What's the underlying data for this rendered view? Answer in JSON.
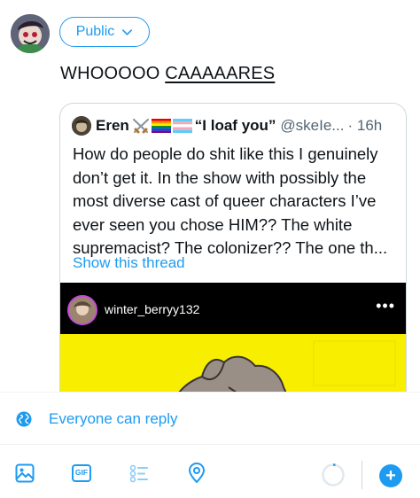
{
  "audience": {
    "label": "Public"
  },
  "compose": {
    "text_plain": "WHOOOOO ",
    "text_underlined": "CAAAAARES"
  },
  "quote": {
    "name": "Eren",
    "name_suffix": "“I loaf you”",
    "handle": "@skeIe...",
    "time": "· 16h",
    "body": "How do people do shit like this I genuinely don’t get it. In the show with possibly the most diverse cast of queer characters I’ve ever seen you chose HIM?? The white supremacist? The colonizer?? The one th...",
    "show_thread": "Show this thread",
    "media": {
      "username": "winter_berryy132",
      "more": "•••"
    }
  },
  "reply_setting": {
    "label": "Everyone can reply"
  },
  "toolbar": {
    "gif_label": "GIF",
    "add": "+"
  },
  "colors": {
    "accent": "#1d9bf0",
    "text": "#0f1419",
    "muted": "#536471",
    "border": "#cfd9de",
    "media_yellow": "#f7ee00"
  },
  "icons": [
    "media-icon",
    "gif-icon",
    "poll-icon",
    "location-icon",
    "globe-icon",
    "chevron-down-icon",
    "more-icon",
    "add-icon"
  ]
}
